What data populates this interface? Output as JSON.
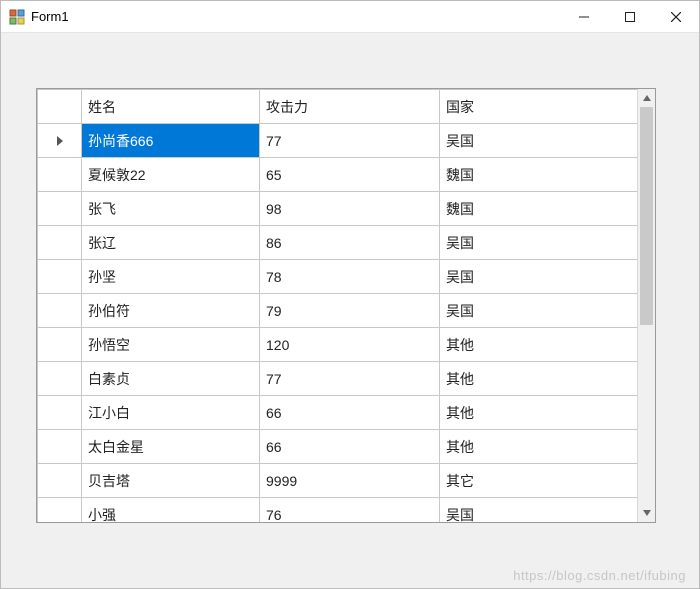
{
  "window": {
    "title": "Form1"
  },
  "grid": {
    "columns": [
      "姓名",
      "攻击力",
      "国家"
    ],
    "selected_row_index": 0,
    "rows": [
      {
        "name": "孙尚香666",
        "attack": "77",
        "country": "吴国"
      },
      {
        "name": "夏候敦22",
        "attack": "65",
        "country": "魏国"
      },
      {
        "name": "张飞",
        "attack": "98",
        "country": "魏国"
      },
      {
        "name": "张辽",
        "attack": "86",
        "country": "吴国"
      },
      {
        "name": "孙坚",
        "attack": "78",
        "country": "吴国"
      },
      {
        "name": "孙伯符",
        "attack": "79",
        "country": "吴国"
      },
      {
        "name": "孙悟空",
        "attack": "120",
        "country": "其他"
      },
      {
        "name": "白素贞",
        "attack": "77",
        "country": "其他"
      },
      {
        "name": "江小白",
        "attack": "66",
        "country": "其他"
      },
      {
        "name": "太白金星",
        "attack": "66",
        "country": "其他"
      },
      {
        "name": "贝吉塔",
        "attack": "9999",
        "country": "其它"
      },
      {
        "name": "小强",
        "attack": "76",
        "country": "吴国"
      }
    ]
  },
  "watermark": "https://blog.csdn.net/ifubing"
}
